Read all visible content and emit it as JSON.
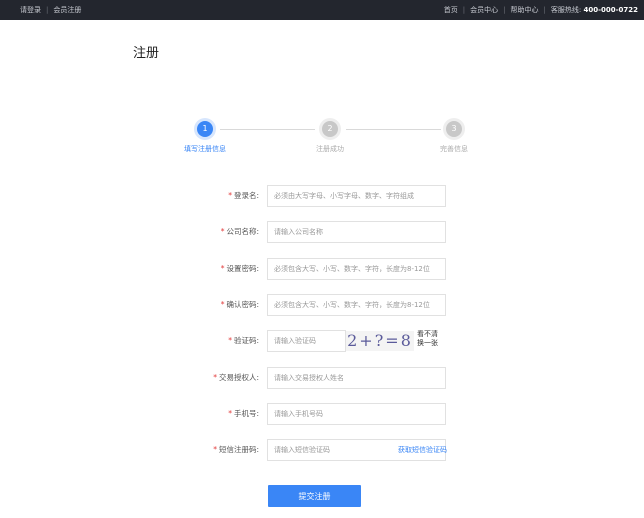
{
  "topbar": {
    "login": "请登录",
    "register": "会员注册",
    "home": "首页",
    "member_center": "会员中心",
    "help_center": "帮助中心",
    "hotline_label": "客服热线:",
    "hotline_number": "400-000-0722"
  },
  "page_title": "注册",
  "steps": [
    {
      "number": "1",
      "label": "填写注册信息",
      "active": true
    },
    {
      "number": "2",
      "label": "注册成功",
      "active": false
    },
    {
      "number": "3",
      "label": "完善信息",
      "active": false
    }
  ],
  "form": {
    "username": {
      "label": "登录名:",
      "placeholder": "必须由大写字母、小写字母、数字、字符组成"
    },
    "company": {
      "label": "公司名称:",
      "placeholder": "请输入公司名称"
    },
    "password": {
      "label": "设置密码:",
      "placeholder": "必须包含大写、小写、数字、字符，长度为8-12位"
    },
    "confirm_password": {
      "label": "确认密码:",
      "placeholder": "必须包含大写、小写、数字、字符，长度为8-12位"
    },
    "captcha": {
      "label": "验证码:",
      "placeholder": "请输入验证码",
      "image_text": "2+?=8",
      "refresh_line1": "看不清",
      "refresh_line2": "换一张"
    },
    "authorized_person": {
      "label": "交易授权人:",
      "placeholder": "请输入交易授权人姓名"
    },
    "phone": {
      "label": "手机号:",
      "placeholder": "请输入手机号码"
    },
    "sms_code": {
      "label": "短信注册码:",
      "placeholder": "请输入短信验证码",
      "link": "获取短信验证码"
    },
    "submit_label": "提交注册"
  },
  "colors": {
    "accent": "#3a86f6",
    "required": "#e23b3b",
    "topbar": "#23262e"
  }
}
